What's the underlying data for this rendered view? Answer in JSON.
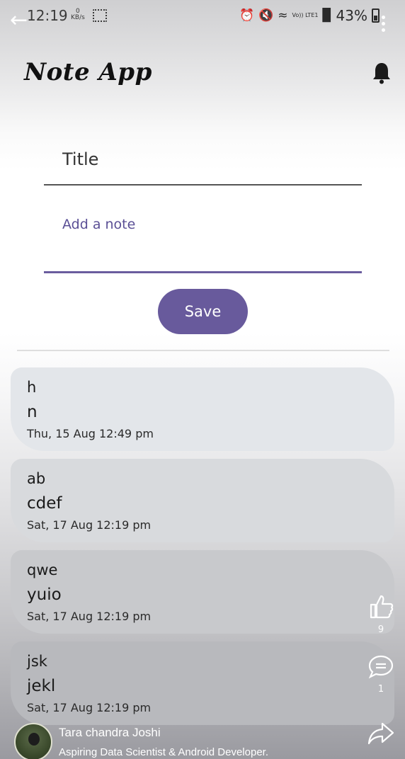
{
  "status_bar": {
    "time": "12:19",
    "network_speed_value": "0",
    "network_speed_unit": "KB/s",
    "network_type": "Vo)) LTE1",
    "battery_percent": "43%"
  },
  "app_bar": {
    "title": "Note App",
    "notification_icon": "bell-icon"
  },
  "form": {
    "title_placeholder": "Title",
    "note_placeholder": "Add a note",
    "save_label": "Save"
  },
  "notes": [
    {
      "title": "h",
      "body": "n",
      "date": "Thu, 15 Aug 12:49 pm"
    },
    {
      "title": "ab",
      "body": "cdef",
      "date": "Sat, 17 Aug 12:19 pm"
    },
    {
      "title": "qwe",
      "body": "yuio",
      "date": "Sat, 17 Aug 12:19 pm"
    },
    {
      "title": "jsk",
      "body": "jekl",
      "date": "Sat, 17 Aug 12:19 pm"
    }
  ],
  "overlay": {
    "likes": "9",
    "comments": "1",
    "author_name": "Tara chandra Joshi",
    "author_bio": "Aspiring Data Scientist & Android Developer."
  },
  "colors": {
    "accent": "#685a9c",
    "card_bg": "#e3e6ea",
    "note_underline": "#6a5c9e"
  }
}
